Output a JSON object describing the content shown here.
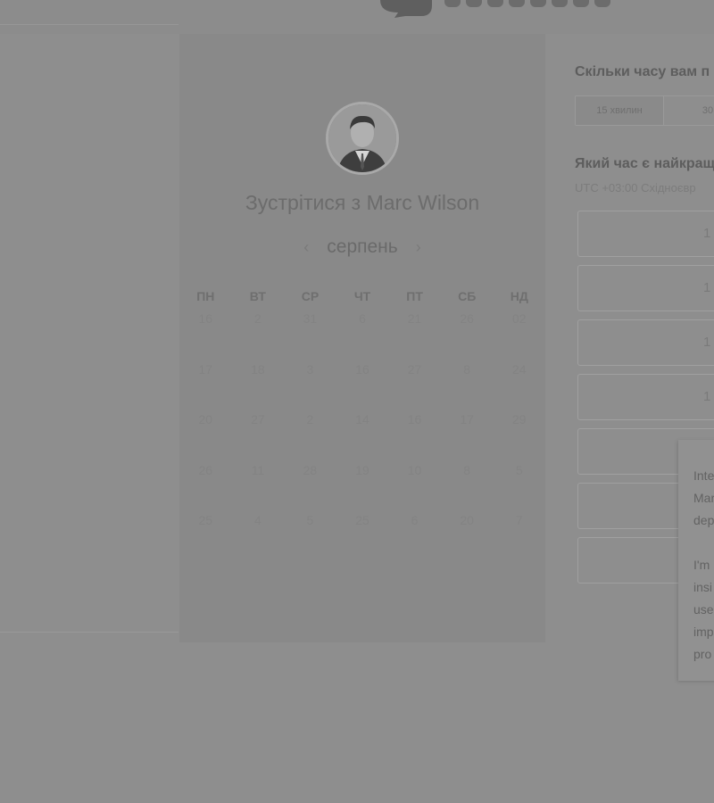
{
  "header": {
    "logo_icon": "chat-bubble-icon"
  },
  "calendar": {
    "host_title": "Зустрітися з Marc Wilson",
    "month": "серпень",
    "prev_icon": "chevron-left-icon",
    "next_icon": "chevron-right-icon",
    "weekdays": [
      "ПН",
      "ВТ",
      "СР",
      "ЧТ",
      "ПТ",
      "СБ",
      "НД"
    ],
    "days": [
      "16",
      "2",
      "31",
      "6",
      "21",
      "26",
      "02",
      "17",
      "18",
      "3",
      "16",
      "27",
      "8",
      "24",
      "20",
      "27",
      "2",
      "14",
      "16",
      "17",
      "29",
      "26",
      "11",
      "28",
      "19",
      "10",
      "8",
      "5",
      "25",
      "4",
      "5",
      "25",
      "6",
      "20",
      "7"
    ]
  },
  "booking": {
    "duration_question": "Скільки часу вам п",
    "durations": [
      "15 хвилин",
      "30"
    ],
    "time_question": "Який час є найкращ",
    "timezone": "UTC +03:00 Східноєвр",
    "slots": [
      "1",
      "1",
      "1",
      "1",
      "",
      "",
      ""
    ]
  },
  "popup": {
    "lines": [
      "Inte",
      "Mar",
      "dep",
      "",
      "I'm",
      "insi",
      "use",
      "imp",
      "pro"
    ]
  }
}
